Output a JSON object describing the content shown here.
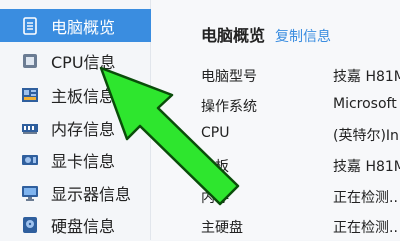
{
  "colors": {
    "accent": "#3a8de0",
    "arrow": "#2ee62e",
    "arrow_outline": "#0a4d0a"
  },
  "sidebar": {
    "items": [
      {
        "label": "电脑概览",
        "icon": "computer-overview-icon",
        "active": true
      },
      {
        "label": "CPU信息",
        "icon": "cpu-icon",
        "active": false
      },
      {
        "label": "主板信息",
        "icon": "motherboard-icon",
        "active": false
      },
      {
        "label": "内存信息",
        "icon": "memory-icon",
        "active": false
      },
      {
        "label": "显卡信息",
        "icon": "graphics-card-icon",
        "active": false
      },
      {
        "label": "显示器信息",
        "icon": "monitor-icon",
        "active": false
      },
      {
        "label": "硬盘信息",
        "icon": "disk-icon",
        "active": false
      }
    ]
  },
  "main": {
    "title": "电脑概览",
    "copy_label": "复制信息",
    "rows": [
      {
        "key": "电脑型号",
        "value": "技嘉 H81M"
      },
      {
        "key": "操作系统",
        "value": "Microsoft"
      },
      {
        "key": "CPU",
        "value": "(英特尔)In"
      },
      {
        "key": "主板",
        "value": "技嘉 H81M"
      },
      {
        "key": "内存",
        "value": "正在检测.."
      },
      {
        "key": "主硬盘",
        "value": "正在检测.."
      }
    ]
  }
}
